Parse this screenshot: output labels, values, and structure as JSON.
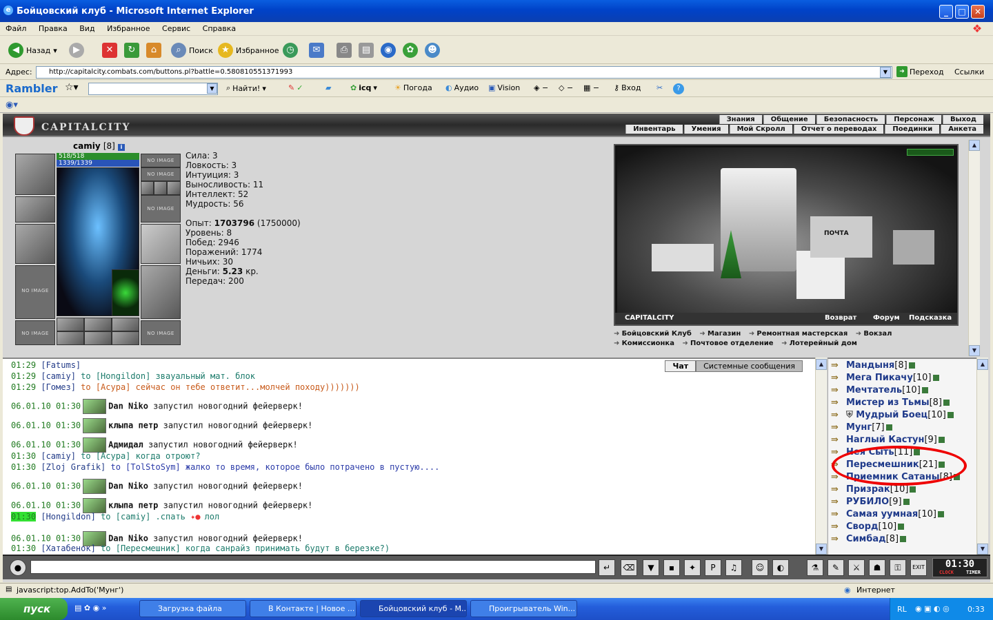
{
  "window": {
    "title": "Бойцовский клуб - Microsoft Internet Explorer"
  },
  "menu": [
    "Файл",
    "Правка",
    "Вид",
    "Избранное",
    "Сервис",
    "Справка"
  ],
  "toolbar": {
    "back": "Назад",
    "search": "Поиск",
    "favorites": "Избранное"
  },
  "address": {
    "label": "Адрес:",
    "url": "http://capitalcity.combats.com/buttons.pl?battle=0.580810551371993",
    "go": "Переход",
    "links": "Ссылки"
  },
  "rambler": {
    "logo": "Rambler",
    "find": "Найти!",
    "icq": "icq",
    "weather": "Погода",
    "audio": "Аудио",
    "vision": "Vision",
    "login": "Вход"
  },
  "game": {
    "logo": "CAPITALCITY",
    "nav_top": [
      "Знания",
      "Общение",
      "Безопасность",
      "Персонаж",
      "Выход"
    ],
    "nav_bottom": [
      "Инвентарь",
      "Умения",
      "Мой Скролл",
      "Отчет о переводах",
      "Поединки",
      "Анкета"
    ],
    "character": {
      "name": "camiy",
      "level": "[8]",
      "hp": "518/518",
      "mana": "1339/1339",
      "no_image": "NO IMAGE",
      "stats": [
        "Сила: 3",
        "Ловкость: 3",
        "Интуиция: 3",
        "Выносливость: 11",
        "Интеллект: 52",
        "Мудрость: 56"
      ],
      "exp_label": "Опыт: ",
      "exp_value": "1703796",
      "exp_next": " (1750000)",
      "level_line": "Уровень: 8",
      "wins": "Побед: 2946",
      "losses": "Поражений: 1774",
      "draws": "Ничьих: 30",
      "money_label": "Деньги: ",
      "money_value": "5.23",
      "money_unit": " кр.",
      "transfers": "Передач: 200"
    },
    "city": {
      "name": "CAPITALCITY",
      "actions": [
        "Возврат",
        "Форум",
        "Подсказка"
      ],
      "post_label": "ПОЧТА",
      "links": [
        "Бойцовский Клуб",
        "Магазин",
        "Ремонтная мастерская",
        "Вокзал",
        "Комиссионка",
        "Почтовое отделение",
        "Лотерейный дом"
      ]
    },
    "chat_tabs": [
      "Чат",
      "Системные сообщения"
    ],
    "chat": [
      {
        "t": "01:29",
        "n": "[Fatums]",
        "m": ""
      },
      {
        "t": "01:29",
        "n": "[camiy]",
        "m": " to [Hongildon] звауальный мат. блок"
      },
      {
        "t": "01:29",
        "n": "[Гомез]",
        "m": " to [Асура] сейчас он тебе ответит...молчей походу)))))))"
      },
      {
        "t": "06.01.10 01:30",
        "n": "Dan Niko",
        "m": " запустил новогодний фейерверк!"
      },
      {
        "t": "06.01.10 01:30",
        "n": "клыпа петр",
        "m": " запустил новогодний фейерверк!"
      },
      {
        "t": "06.01.10 01:30",
        "n": "Адмидал",
        "m": " запустил новогодний фейерверк!"
      },
      {
        "t": "01:30",
        "n": "[camiy]",
        "m": " to [Асура] когда отроют?"
      },
      {
        "t": "01:30",
        "n": "[Zloj Grafik]",
        "m": " to [TolStoSym] жалко то время, которое было потрачено в пустую...."
      },
      {
        "t": "06.01.10 01:30",
        "n": "Dan Niko",
        "m": " запустил новогодний фейерверк!"
      },
      {
        "t": "06.01.10 01:30",
        "n": "клыпа петр",
        "m": " запустил новогодний фейерверк!"
      },
      {
        "t": "01:30",
        "n": "[Hongildon]",
        "m": " to [camiy] .спать",
        "tail": "лол"
      },
      {
        "t": "06.01.10 01:30",
        "n": "Dan Niko",
        "m": " запустил новогодний фейерверк!"
      },
      {
        "t": "01:30",
        "n": "[Хатабенок]",
        "m": " to [Пересмешник] когда санрайз принимать будут в березке?)"
      }
    ],
    "users": [
      {
        "n": "Мандыня",
        "l": "[8]"
      },
      {
        "n": "Мега Пикачу",
        "l": "[10]"
      },
      {
        "n": "Мечтатель",
        "l": "[10]"
      },
      {
        "n": "Мистер из Тьмы",
        "l": "[8]"
      },
      {
        "n": "Мудрый Боец",
        "l": "[10]"
      },
      {
        "n": "Мунг",
        "l": "[7]"
      },
      {
        "n": "Наглый Кастун",
        "l": "[9]"
      },
      {
        "n": "Нея Сыть",
        "l": "[11]"
      },
      {
        "n": "Пересмешник",
        "l": "[21]"
      },
      {
        "n": "Приемник Сатаны",
        "l": "[8]"
      },
      {
        "n": "Призрак",
        "l": "[10]"
      },
      {
        "n": "РУБИЛО",
        "l": "[9]"
      },
      {
        "n": "Самая уумная",
        "l": "[10]"
      },
      {
        "n": "Сворд",
        "l": "[10]"
      },
      {
        "n": "Симбад",
        "l": "[8]"
      }
    ],
    "clock": {
      "time": "01:30",
      "label1": "CLOCK",
      "label2": "TIMER",
      "exit": "EXIT"
    }
  },
  "status": {
    "text": "javascript:top.AddTo('Мунг')",
    "zone": "Интернет"
  },
  "taskbar": {
    "start": "пуск",
    "tasks": [
      "Загрузка файла",
      "В Контакте | Новое ...",
      "Бойцовский клуб - М...",
      "Проигрыватель Win..."
    ],
    "lang": "RL",
    "time": "0:33"
  },
  "colors": {
    "title_bar": "#0042c8",
    "taskbar": "#245edb",
    "start": "#2c8a2c",
    "annotation": "#e00000"
  }
}
